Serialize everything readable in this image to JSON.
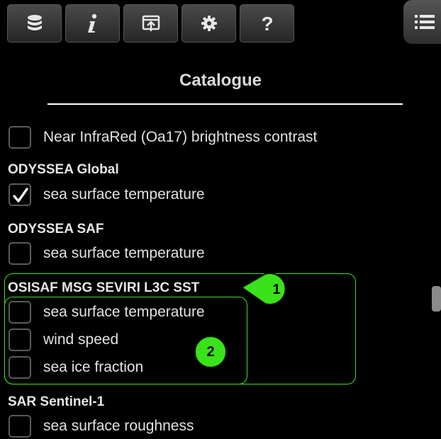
{
  "toolbar": {
    "buttons": [
      {
        "icon": "database-icon",
        "name": "layers-button"
      },
      {
        "icon": "info-icon",
        "name": "info-button"
      },
      {
        "icon": "share-icon",
        "name": "export-button"
      },
      {
        "icon": "gear-icon",
        "name": "settings-button"
      },
      {
        "icon": "help-icon",
        "name": "help-button"
      }
    ],
    "menu_icon": "list-menu-icon"
  },
  "catalogue": {
    "title": "Catalogue",
    "top_item": {
      "label": "Near InfraRed (Oa17) brightness contrast",
      "checked": false
    },
    "groups": [
      {
        "name": "ODYSSEA Global",
        "items": [
          {
            "label": "sea surface temperature",
            "checked": true
          }
        ]
      },
      {
        "name": "ODYSSEA SAF",
        "items": [
          {
            "label": "sea surface temperature",
            "checked": false
          }
        ]
      },
      {
        "name": "OSISAF MSG SEVIRI L3C SST",
        "items": [
          {
            "label": "sea surface temperature",
            "checked": false
          },
          {
            "label": "wind speed",
            "checked": false
          },
          {
            "label": "sea ice fraction",
            "checked": false
          }
        ]
      },
      {
        "name": "SAR Sentinel-1",
        "items": [
          {
            "label": "sea surface roughness",
            "checked": false
          }
        ]
      }
    ]
  },
  "annotations": {
    "callout_1": "1",
    "callout_2": "2",
    "highlight_color": "#35e61a"
  },
  "colors": {
    "background": "#000000",
    "title_text": "#d9d9d9",
    "toolbar_button": "#3a3a3a"
  }
}
